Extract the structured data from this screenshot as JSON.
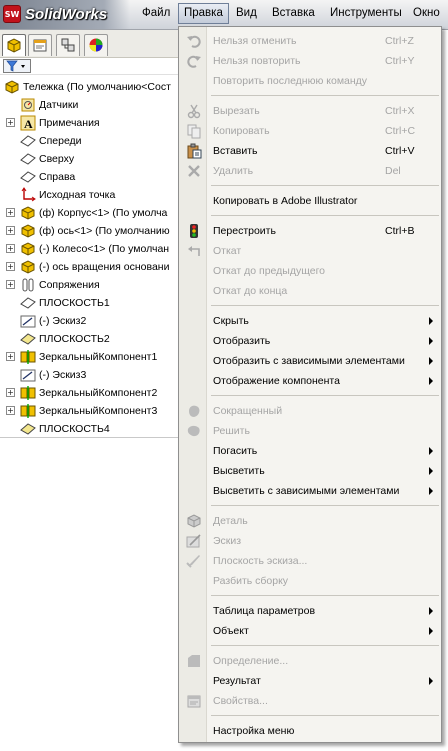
{
  "app": {
    "logo_mark": "SW",
    "name": "SolidWorks"
  },
  "menubar": [
    {
      "label": "Файл"
    },
    {
      "label": "Правка"
    },
    {
      "label": "Вид"
    },
    {
      "label": "Вставка"
    },
    {
      "label": "Инструменты"
    },
    {
      "label": "Окно"
    }
  ],
  "tree": {
    "root": "Тележка  (По умолчанию<Сост",
    "items": [
      "Датчики",
      "Примечания",
      "Спереди",
      "Сверху",
      "Справа",
      "Исходная точка",
      "(ф) Корпус<1> (По умолча",
      "(ф) ось<1> (По умолчанию",
      "(-) Колесо<1> (По умолчан",
      "(-) ось вращения основани",
      "Сопряжения",
      "ПЛОСКОСТЬ1",
      "(-) Эскиз2",
      "ПЛОСКОСТЬ2",
      "ЗеркальныйКомпонент1",
      "(-) Эскиз3",
      "ЗеркальныйКомпонент2",
      "ЗеркальныйКомпонент3",
      "ПЛОСКОСТЬ4"
    ]
  },
  "edit_menu": {
    "undo": {
      "label": "Нельзя отменить",
      "shortcut": "Ctrl+Z"
    },
    "redo": {
      "label": "Нельзя повторить",
      "shortcut": "Ctrl+Y"
    },
    "repeat": {
      "label": "Повторить последнюю команду"
    },
    "cut": {
      "label": "Вырезать",
      "shortcut": "Ctrl+X"
    },
    "copy": {
      "label": "Копировать",
      "shortcut": "Ctrl+C"
    },
    "paste": {
      "label": "Вставить",
      "shortcut": "Ctrl+V"
    },
    "delete": {
      "label": "Удалить",
      "shortcut": "Del"
    },
    "copy_ai": {
      "label": "Копировать в Adobe Illustrator"
    },
    "rebuild": {
      "label": "Перестроить",
      "shortcut": "Ctrl+B"
    },
    "rollback": {
      "label": "Откат"
    },
    "rollback_prev": {
      "label": "Откат до предыдущего"
    },
    "rollback_end": {
      "label": "Откат до конца"
    },
    "hide": {
      "label": "Скрыть"
    },
    "show": {
      "label": "Отобразить"
    },
    "show_dep": {
      "label": "Отобразить с зависимыми элементами"
    },
    "comp_display": {
      "label": "Отображение компонента"
    },
    "lightweight": {
      "label": "Сокращенный"
    },
    "resolve": {
      "label": "Решить"
    },
    "suppress": {
      "label": "Погасить"
    },
    "unsuppress": {
      "label": "Высветить"
    },
    "unsuppress_dep": {
      "label": "Высветить с зависимыми элементами"
    },
    "part": {
      "label": "Деталь"
    },
    "sketch": {
      "label": "Эскиз"
    },
    "sketch_plane": {
      "label": "Плоскость эскиза..."
    },
    "dissolve": {
      "label": "Разбить сборку"
    },
    "design_table": {
      "label": "Таблица параметров"
    },
    "object": {
      "label": "Объект"
    },
    "definition": {
      "label": "Определение..."
    },
    "result": {
      "label": "Результат"
    },
    "properties": {
      "label": "Свойства..."
    },
    "customize": {
      "label": "Настройка меню"
    }
  },
  "colors": {
    "accent": "#c1121b",
    "menu_bg": "#f5f4f0",
    "disabled_text": "#a5a5a5"
  }
}
